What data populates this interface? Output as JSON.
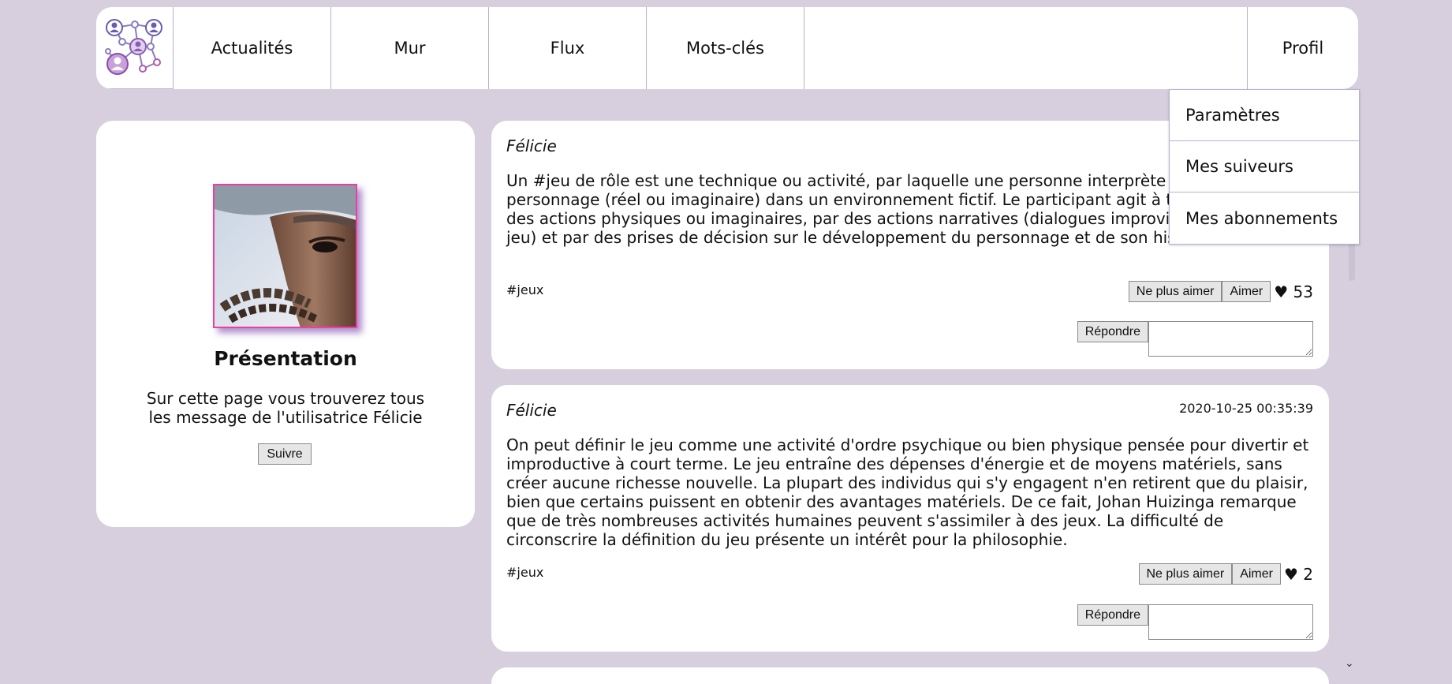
{
  "nav": {
    "items": [
      {
        "label": "Actualités"
      },
      {
        "label": "Mur"
      },
      {
        "label": "Flux"
      },
      {
        "label": "Mots-clés"
      }
    ],
    "profile_label": "Profil"
  },
  "dropdown": {
    "items": [
      {
        "label": "Paramètres"
      },
      {
        "label": "Mes suiveurs"
      },
      {
        "label": "Mes abonnements"
      }
    ]
  },
  "profile": {
    "title": "Présentation",
    "description": "Sur cette page vous trouverez tous les message de l'utilisatrice Félicie",
    "follow_label": "Suivre"
  },
  "posts": [
    {
      "author": "Félicie",
      "date": "",
      "body": "Un #jeu de rôle est une technique ou activité, par laquelle une personne interprète le rôle d'un personnage (réel ou imaginaire) dans un environnement fictif. Le participant agit à travers ce rôle par des actions physiques ou imaginaires, par des actions narratives (dialogues improvisés, descriptions, jeu) et par des prises de décision sur le développement du personnage et de son histoire.",
      "tag": "#jeux",
      "unlike_label": "Ne plus aimer",
      "like_label": "Aimer",
      "likes": "♥ 53",
      "reply_label": "Répondre"
    },
    {
      "author": "Félicie",
      "date": "2020-10-25 00:35:39",
      "body": "On peut définir le jeu comme une activité d'ordre psychique ou bien physique pensée pour divertir et improductive à court terme. Le jeu entraîne des dépenses d'énergie et de moyens matériels, sans créer aucune richesse nouvelle. La plupart des individus qui s'y engagent n'en retirent que du plaisir, bien que certains puissent en obtenir des avantages matériels. De ce fait, Johan Huizinga remarque que de très nombreuses activités humaines peuvent s'assimiler à des jeux. La difficulté de circonscrire la définition du jeu présente un intérêt pour la philosophie.",
      "tag": "#jeux",
      "unlike_label": "Ne plus aimer",
      "like_label": "Aimer",
      "likes": "♥ 2",
      "reply_label": "Répondre"
    }
  ],
  "icons": {
    "logo": "social-network-logo-icon",
    "scroll_down": "chevron-down-icon"
  },
  "colors": {
    "background": "#d8cfde",
    "accent": "#ee3fa0",
    "border": "#b8b0d0"
  }
}
